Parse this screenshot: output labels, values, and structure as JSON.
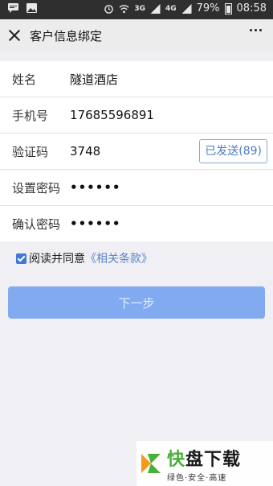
{
  "statusbar": {
    "battery": "79%",
    "time": "08:58",
    "network": "3G",
    "network2": "4G"
  },
  "header": {
    "title": "客户信息绑定"
  },
  "form": {
    "rows": [
      {
        "label": "姓名",
        "value": "隧道酒店"
      },
      {
        "label": "手机号",
        "value": "17685596891"
      },
      {
        "label": "验证码",
        "value": "3748"
      },
      {
        "label": "设置密码",
        "value": "••••••"
      },
      {
        "label": "确认密码",
        "value": "••••••"
      }
    ],
    "send_button": "已发送(89)"
  },
  "agree": {
    "text": "阅读并同意",
    "link": "《相关条款》"
  },
  "next_button": "下一步",
  "watermark": {
    "main_a": "快",
    "main_b": "盘下载",
    "sub": "绿色·安全·高速"
  },
  "colors": {
    "accent": "#82aaf0",
    "link": "#5b86c8",
    "logo_green": "#48b035",
    "logo_orange": "#f39a1c"
  }
}
